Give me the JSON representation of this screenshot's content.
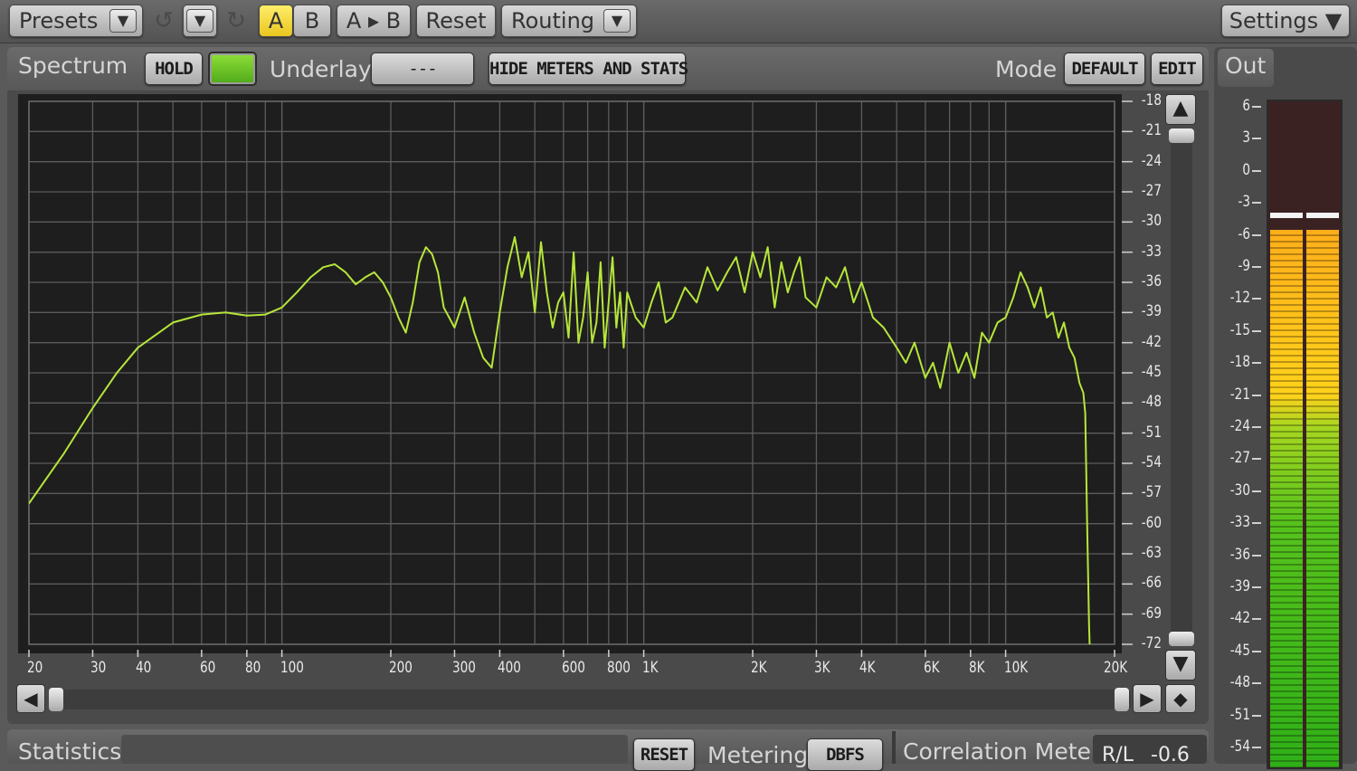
{
  "toolbar": {
    "presets_label": "Presets",
    "undo_icon": "undo-icon",
    "redo_icon": "redo-icon",
    "a_label": "A",
    "b_label": "B",
    "copy_label": "A ▸ B",
    "reset_label": "Reset",
    "routing_label": "Routing",
    "settings_label": "Settings ▼"
  },
  "spectrum": {
    "title": "Spectrum",
    "hold_label": "HOLD",
    "underlay_label": "Underlay",
    "underlay_value": "---",
    "hide_label": "HIDE METERS AND STATS",
    "mode_label": "Mode",
    "mode_value": "DEFAULT",
    "edit_label": "EDIT"
  },
  "out_meter": {
    "title": "Out",
    "ticks": [
      "6",
      "3",
      "0",
      "-3",
      "-6",
      "-9",
      "-12",
      "-15",
      "-18",
      "-21",
      "-24",
      "-27",
      "-30",
      "-33",
      "-36",
      "-39",
      "-42",
      "-45",
      "-48",
      "-51",
      "-54"
    ],
    "peak_db": -4.2,
    "level_db": -5.5,
    "colors": {
      "top": "#ffae1a",
      "mid": "#ffd21a",
      "low": "#2fb018",
      "bg": "#3a2222"
    }
  },
  "bottom": {
    "statistics_label": "Statistics",
    "reset_label": "RESET",
    "metering_label": "Metering",
    "metering_value": "DBFS",
    "correlation_label": "Correlation Meter",
    "rl_label": "R/L",
    "rl_value": "-0.6"
  },
  "chart_data": {
    "type": "line",
    "title": "",
    "xlabel": "",
    "ylabel": "",
    "x_scale": "log",
    "xlim": [
      20,
      20000
    ],
    "ylim": [
      -72,
      -18
    ],
    "grid": true,
    "line_color": "#b6e63a",
    "x_tick_labels": [
      "20",
      "30",
      "40",
      "60",
      "80",
      "100",
      "200",
      "300",
      "400",
      "600",
      "800",
      "1K",
      "2K",
      "3K",
      "4K",
      "6K",
      "8K",
      "10K",
      "20K"
    ],
    "y_tick_labels": [
      "-18",
      "-21",
      "-24",
      "-27",
      "-30",
      "-33",
      "-36",
      "-39",
      "-42",
      "-45",
      "-48",
      "-51",
      "-54",
      "-57",
      "-60",
      "-63",
      "-66",
      "-69",
      "-72"
    ],
    "series": [
      {
        "x": [
          20,
          25,
          30,
          35,
          40,
          50,
          60,
          70,
          80,
          90,
          100,
          110,
          120,
          130,
          140,
          150,
          160,
          170,
          180,
          190,
          200,
          210,
          220,
          230,
          240,
          250,
          260,
          270,
          280,
          290,
          300,
          320,
          340,
          360,
          380,
          400,
          420,
          440,
          460,
          480,
          500,
          520,
          540,
          560,
          580,
          600,
          620,
          640,
          660,
          680,
          700,
          720,
          740,
          760,
          780,
          800,
          820,
          840,
          860,
          880,
          900,
          950,
          1000,
          1050,
          1100,
          1150,
          1200,
          1300,
          1400,
          1500,
          1600,
          1700,
          1800,
          1900,
          2000,
          2100,
          2200,
          2300,
          2400,
          2500,
          2600,
          2700,
          2800,
          3000,
          3200,
          3400,
          3600,
          3800,
          4000,
          4300,
          4600,
          5000,
          5300,
          5600,
          6000,
          6300,
          6600,
          7000,
          7400,
          7800,
          8200,
          8600,
          9000,
          9500,
          10000,
          10500,
          11000,
          11500,
          12000,
          12500,
          13000,
          13500,
          14000,
          14500,
          15000,
          15500,
          16000,
          16400,
          16600,
          16800,
          17000,
          17100,
          17200
        ],
        "y": [
          -58,
          -53,
          -48.5,
          -45,
          -42.5,
          -40,
          -39.2,
          -39,
          -39.3,
          -39.2,
          -38.5,
          -37,
          -35.5,
          -34.5,
          -34.2,
          -35,
          -36.2,
          -35.5,
          -35,
          -36,
          -37.5,
          -39.5,
          -41,
          -38,
          -34,
          -32.5,
          -33.2,
          -35,
          -38.5,
          -39.5,
          -40.5,
          -37.5,
          -41,
          -43.5,
          -44.5,
          -39,
          -34.5,
          -31.5,
          -35.5,
          -33,
          -39,
          -32,
          -37,
          -40.5,
          -38,
          -37,
          -41.5,
          -33,
          -42,
          -39.5,
          -35,
          -42,
          -40,
          -34,
          -42.5,
          -38,
          -33.5,
          -40.5,
          -37,
          -42.5,
          -37,
          -39.5,
          -40.5,
          -38,
          -36,
          -40,
          -39.5,
          -36.5,
          -38,
          -34.5,
          -36.8,
          -35,
          -33.5,
          -37,
          -33,
          -35.5,
          -32.5,
          -38.5,
          -34,
          -37,
          -35,
          -33.5,
          -37.5,
          -38.5,
          -35.5,
          -36.5,
          -34.5,
          -38,
          -36,
          -39.5,
          -40.5,
          -42.5,
          -44,
          -42,
          -45.5,
          -44,
          -46.5,
          -42,
          -45,
          -43,
          -45.5,
          -41,
          -42,
          -40,
          -39.5,
          -37.5,
          -35,
          -36.5,
          -38.5,
          -36.5,
          -39.5,
          -39,
          -41.5,
          -40,
          -42.5,
          -43.5,
          -46,
          -47,
          -49,
          -60,
          -70,
          -73,
          -74
        ]
      }
    ]
  }
}
